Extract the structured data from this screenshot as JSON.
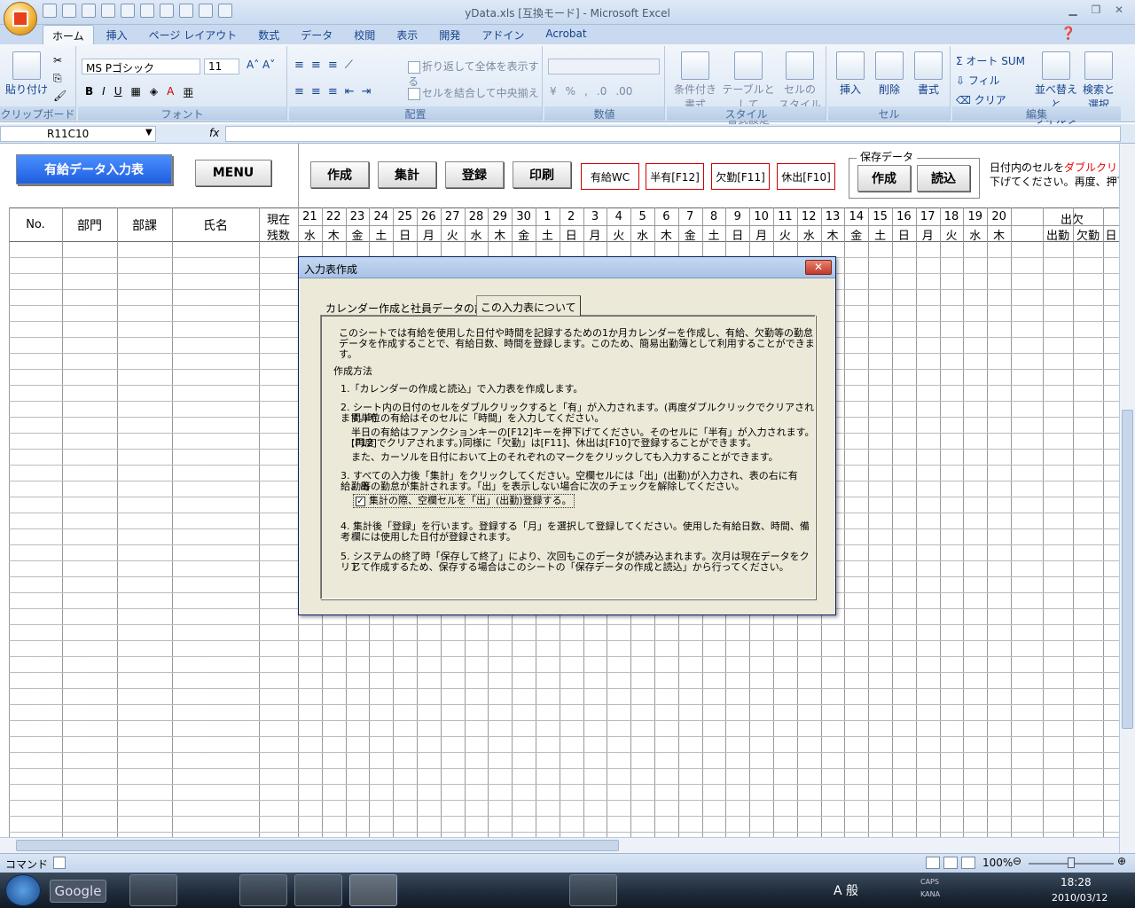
{
  "window": {
    "title": "yData.xls  [互換モード] - Microsoft Excel"
  },
  "ribbon_tabs": [
    "ホーム",
    "挿入",
    "ページ レイアウト",
    "数式",
    "データ",
    "校閲",
    "表示",
    "開発",
    "アドイン",
    "Acrobat"
  ],
  "ribbon": {
    "paste": "貼り付け",
    "clipboard": "クリップボード",
    "font_name": "MS Pゴシック",
    "font_size": "11",
    "font": "フォント",
    "wrap_text": "折り返して全体を表示する",
    "merge_center": "セルを結合して中央揃え",
    "alignment": "配置",
    "number": "数値",
    "cond_format": "条件付き\n書式",
    "table_format": "テーブルとして\n書式設定",
    "cell_style": "セルの\nスタイル",
    "style": "スタイル",
    "insert": "挿入",
    "delete": "削除",
    "format": "書式",
    "cells": "セル",
    "autosum": "Σ オート SUM",
    "fill": "フィル",
    "clear": "クリア",
    "sort_filter": "並べ替えと\nフィルタ",
    "find_select": "検索と\n選択",
    "editing": "編集"
  },
  "formula_bar": {
    "name_box": "R11C10",
    "fx": "fx"
  },
  "sheet": {
    "title_button": "有給データ入力表",
    "menu_button": "MENU",
    "action_buttons": [
      "作成",
      "集計",
      "登録",
      "印刷"
    ],
    "mark_buttons": [
      "有給WC",
      "半有[F12]",
      "欠勤[F11]",
      "休出[F10]"
    ],
    "save_group_label": "保存データ",
    "save_create": "作成",
    "save_load": "読込",
    "note_line1_a": "日付内のセルを",
    "note_line1_b": "ダブルクリッ",
    "note_line2": "下げてください。再度、押下げ",
    "headers": {
      "no": "No.",
      "dept": "部門",
      "section": "部課",
      "name": "氏名",
      "current1": "現在",
      "current2": "残数",
      "attend": "出欠",
      "present": "出勤",
      "absent": "欠勤",
      "last": "日"
    },
    "days": [
      "21",
      "22",
      "23",
      "24",
      "25",
      "26",
      "27",
      "28",
      "29",
      "30",
      "1",
      "2",
      "3",
      "4",
      "5",
      "6",
      "7",
      "8",
      "9",
      "10",
      "11",
      "12",
      "13",
      "14",
      "15",
      "16",
      "17",
      "18",
      "19",
      "20"
    ],
    "weekdays": [
      "水",
      "木",
      "金",
      "土",
      "日",
      "月",
      "火",
      "水",
      "木",
      "金",
      "土",
      "日",
      "月",
      "火",
      "水",
      "木",
      "金",
      "土",
      "日",
      "月",
      "火",
      "水",
      "木",
      "金",
      "土",
      "日",
      "月",
      "火",
      "水",
      "木"
    ]
  },
  "dialog": {
    "title": "入力表作成",
    "close": "✕",
    "tab1": "カレンダー作成と社員データの読込",
    "tab2": "この入力表について",
    "intro1": "このシートでは有給を使用した日付や時間を記録するための1か月カレンダーを作成し、有給、欠勤等の勤怠",
    "intro2": "データを作成することで、有給日数、時間を登録します。このため、簡易出勤簿として利用することができます。",
    "method_title": "作成方法",
    "s1": "1.「カレンダーの作成と読込」で入力表を作成します。",
    "s2a": "2. シート内の日付のセルをダブルクリックすると「有」が入力されます。(再度ダブルクリックでクリアされます。)時",
    "s2b": "間単位の有給はそのセルに「時間」を入力してください。",
    "s2c": "半日の有給はファンクションキーの[F12]キーを押下げてください。そのセルに「半有」が入力されます。(再度",
    "s2d": "[F12]でクリアされます。)同様に「欠勤」は[F11]、休出は[F10]で登録することができます。",
    "s2e": "また、カーソルを日付において上のそれぞれのマークをクリックしても入力することができます。",
    "s3a": "3. すべての入力後「集計」をクリックしてください。空欄セルには「出」(出勤)が入力され、表の右に有給、出",
    "s3b": "勤等の勤怠が集計されます。「出」を表示しない場合に次のチェックを解除してください。",
    "checkbox": "集計の際、空欄セルを「出」(出勤)登録する。",
    "check_mark": "✓",
    "s4a": "4. 集計後「登録」を行います。登録する「月」を選択して登録してください。使用した有給日数、時間、備考",
    "s4b": "欄には使用した日付が登録されます。",
    "s5a": "5. システムの終了時「保存して終了」により、次回もこのデータが読み込まれます。次月は現在データをクリア",
    "s5b": "して作成するため、保存する場合はこのシートの「保存データの作成と読込」から行ってください。"
  },
  "status_bar": {
    "mode": "コマンド",
    "zoom": "100%"
  },
  "taskbar": {
    "google": "Google",
    "ime": "A 般",
    "caps": "CAPS",
    "kana": "KANA",
    "time": "18:28",
    "date": "2010/03/12"
  }
}
